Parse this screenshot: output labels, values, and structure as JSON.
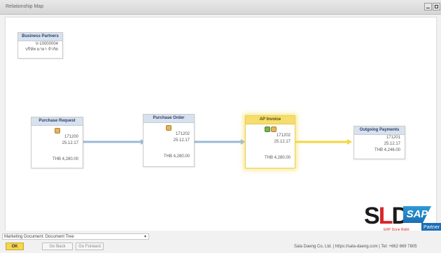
{
  "window": {
    "title": "Relationship Map"
  },
  "nodes": {
    "business_partners": {
      "title": "Business Partners",
      "code": "V-10000004",
      "name": "บริษัท มายา จำกัด"
    },
    "purchase_request": {
      "title": "Purchase Request",
      "doc_no": "171200",
      "date": "25.12.17",
      "amount": "THB 4,280.00"
    },
    "purchase_order": {
      "title": "Purchase Order",
      "doc_no": "171202",
      "date": "25.12.17",
      "amount": "THB 4,280.00"
    },
    "ap_invoice": {
      "title": "AP Invoice",
      "doc_no": "171202",
      "date": "25.12.17",
      "amount": "THB 4,280.00"
    },
    "outgoing_payments": {
      "title": "Outgoing Payments",
      "doc_no": "171201",
      "date": "25.12.17",
      "amount": "THB 4,246.00"
    }
  },
  "colors": {
    "flow_line": "#9bb8d8",
    "flow_line_selected": "#f6d63c",
    "accent_yellow": "#f4d64f"
  },
  "bottom": {
    "view_select": "Marketing Document: Document Tree",
    "ok_label": "OK",
    "back_label": "Go Back",
    "forward_label": "Go Forward",
    "footer_text": "Sala Daeng Co, Ltd. | https://sala-daeng.com | Tel: +662 669 7805"
  },
  "logo": {
    "sld_s": "S",
    "sld_l": "L",
    "sld_d": "D",
    "tagline": "ERP Done Right",
    "sap": "SAP",
    "partner": "Partner"
  }
}
